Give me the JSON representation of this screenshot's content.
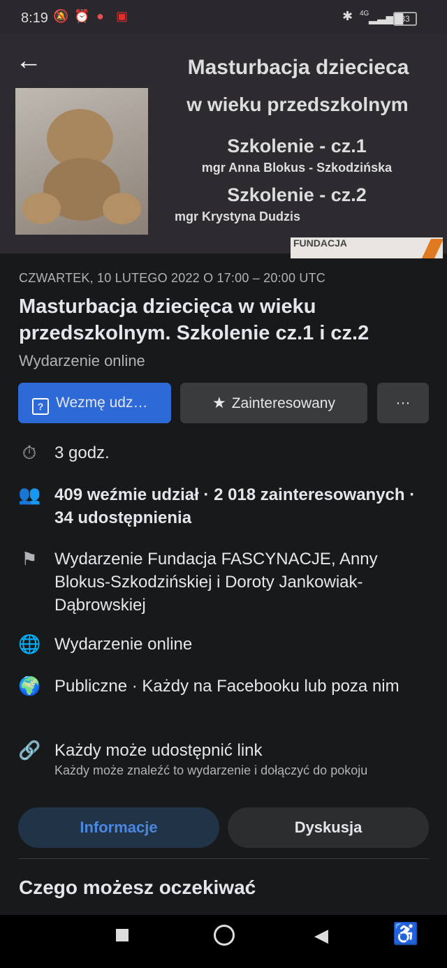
{
  "status_bar": {
    "time": "8:19",
    "network": "4G",
    "battery": "83"
  },
  "cover": {
    "title_line1": "Masturbacja dziecieca",
    "title_line2": "w  wieku przedszkolnym",
    "part1": "Szkolenie - cz.1",
    "author1": "mgr Anna Blokus - Szkodzińska",
    "part2": "Szkolenie - cz.2",
    "author2": "mgr Krystyna Dudzis",
    "logo_text": "FUNDACJA"
  },
  "event": {
    "datetime": "CZWARTEK, 10 LUTEGO 2022 O 17:00 – 20:00 UTC",
    "title": "Masturbacja dziecięca w wieku przedszkolnym. Szkolenie cz.1 i cz.2",
    "type": "Wydarzenie online"
  },
  "actions": {
    "going": "Wezmę udz…",
    "interested": "Zainteresowany",
    "more": "···"
  },
  "details": {
    "duration": "3 godz.",
    "attendance": "409 weźmie udział · 2 018 zainteresowanych · 34 udostępnienia",
    "organizer": "Wydarzenie Fundacja FASCYNACJE, Anny Blokus-Szkodzińskiej i Doroty Jankowiak-Dąbrowskiej",
    "online": "Wydarzenie online",
    "privacy": "Publiczne · Każdy na Facebooku lub poza nim",
    "link_title": "Każdy może udostępnić link",
    "link_desc": "Każdy może znaleźć to wydarzenie i dołączyć do pokoju"
  },
  "tabs": {
    "info": "Informacje",
    "discussion": "Dyskusja"
  },
  "section_heading": "Czego możesz oczekiwać",
  "icons": [
    "mute-icon",
    "alarm-icon",
    "app-icon",
    "youtube-icon",
    "bluetooth-icon",
    "signal-icon",
    "battery-icon",
    "back-arrow-icon",
    "stopwatch-icon",
    "people-icon",
    "flag-icon",
    "globe-icon",
    "public-globe-icon",
    "link-icon",
    "star-icon",
    "question-box-icon"
  ]
}
